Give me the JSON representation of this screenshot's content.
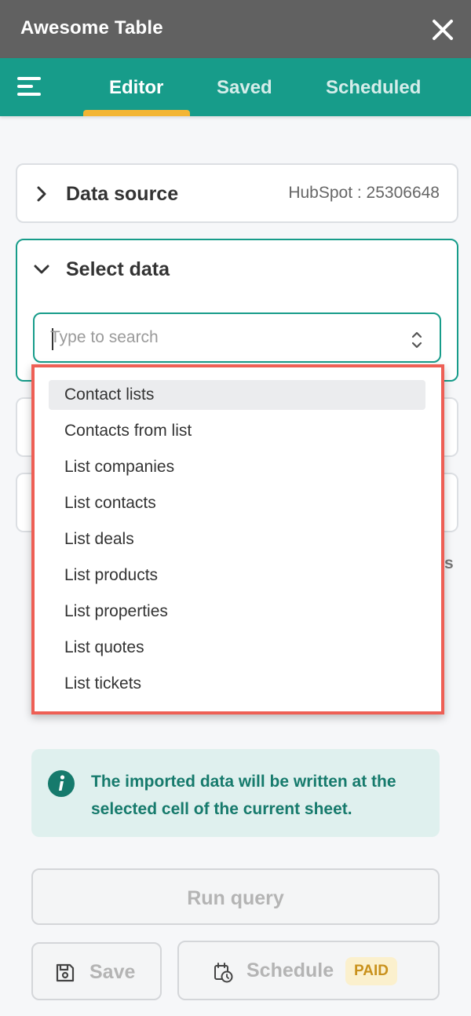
{
  "app": {
    "title": "Awesome Table"
  },
  "tabs": [
    {
      "label": "Editor",
      "active": true
    },
    {
      "label": "Saved",
      "active": false
    },
    {
      "label": "Scheduled",
      "active": false
    }
  ],
  "data_source": {
    "title": "Data source",
    "value": "HubSpot : 25306648"
  },
  "select_data": {
    "title": "Select data",
    "placeholder": "Type to search"
  },
  "dropdown": {
    "items": [
      "Contact lists",
      "Contacts from list",
      "List companies",
      "List contacts",
      "List deals",
      "List products",
      "List properties",
      "List quotes",
      "List tickets"
    ],
    "highlighted": "Contact lists"
  },
  "peek": {
    "s": "s"
  },
  "info": {
    "text": "The imported data will be written at the selected cell of the current sheet."
  },
  "buttons": {
    "run": "Run query",
    "save": "Save",
    "schedule": "Schedule",
    "paid_badge": "PAID"
  },
  "colors": {
    "header": "#616161",
    "accent": "#179c8a",
    "tab_indicator": "#f3b533",
    "highlight_border": "#ee5f55",
    "info_bg": "#dff0ee",
    "info_text": "#167a6c"
  }
}
